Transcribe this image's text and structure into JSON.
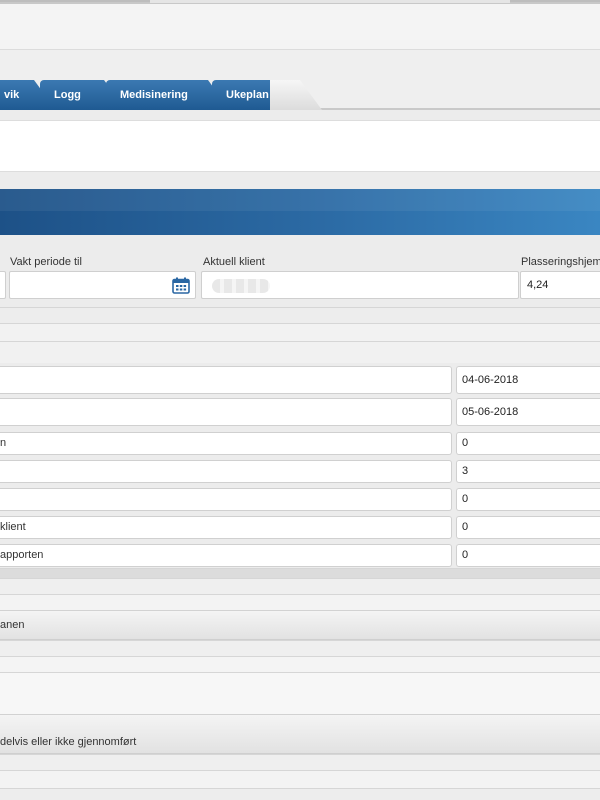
{
  "tabs": [
    {
      "label": "vik"
    },
    {
      "label": "Logg"
    },
    {
      "label": "Medisinering"
    },
    {
      "label": "Ukeplan"
    }
  ],
  "fields": {
    "vakt_periode_til": {
      "label": "Vakt periode til",
      "value": ""
    },
    "aktuell_klient": {
      "label": "Aktuell klient",
      "value": ""
    },
    "plasseringshjem": {
      "label": "Plasseringshjem",
      "value": "4,24"
    }
  },
  "rows": [
    {
      "label": "",
      "value": "04-06-2018"
    },
    {
      "label": "",
      "value": "05-06-2018"
    },
    {
      "label": "n",
      "value": "0"
    },
    {
      "label": "",
      "value": "3"
    },
    {
      "label": "",
      "value": "0"
    },
    {
      "label": "klient",
      "value": "0"
    },
    {
      "label": "apporten",
      "value": "0"
    }
  ],
  "sections": {
    "planen": "anen",
    "delvis": "delvis eller ikke gjennomført"
  },
  "colors": {
    "tab_blue": "#2a67a3",
    "header_blue_dark": "#1d5187",
    "header_blue_light": "#3a86c2"
  },
  "icons": {
    "calendar": "calendar-icon"
  }
}
